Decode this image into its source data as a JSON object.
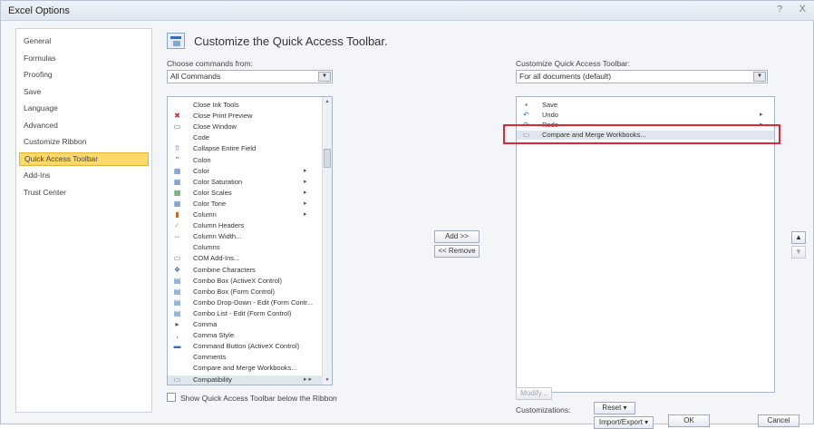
{
  "window": {
    "title": "Excel Options",
    "help_label": "?",
    "close_label": "X"
  },
  "nav": {
    "items": [
      {
        "label": "General"
      },
      {
        "label": "Formulas"
      },
      {
        "label": "Proofing"
      },
      {
        "label": "Save"
      },
      {
        "label": "Language"
      },
      {
        "label": "Advanced"
      },
      {
        "label": "Customize Ribbon"
      },
      {
        "label": "Quick Access Toolbar",
        "selected": true
      },
      {
        "label": "Add-Ins"
      },
      {
        "label": "Trust Center"
      }
    ]
  },
  "main": {
    "heading": "Customize the Quick Access Toolbar.",
    "choose_label": "Choose commands from:",
    "choose_value": "All Commands",
    "customize_label": "Customize Quick Access Toolbar:",
    "customize_value": "For all documents (default)",
    "commands": [
      {
        "label": "Close Ink Tools",
        "icon": "",
        "sub": "",
        "ico_color": "#333"
      },
      {
        "label": "Close Print Preview",
        "icon": "✖",
        "sub": "",
        "ico_color": "#cc3333"
      },
      {
        "label": "Close Window",
        "icon": "▭",
        "sub": "",
        "ico_color": "#555"
      },
      {
        "label": "Code",
        "icon": "",
        "sub": "",
        "ico_color": "#333"
      },
      {
        "label": "Collapse Entire Field",
        "icon": "⇧",
        "sub": "",
        "ico_color": "#3b6db4"
      },
      {
        "label": "Colon",
        "icon": "\"",
        "sub": "",
        "ico_color": "#333"
      },
      {
        "label": "Color",
        "icon": "▦",
        "sub": "▸",
        "ico_color": "#4a7cc0"
      },
      {
        "label": "Color Saturation",
        "icon": "▦",
        "sub": "▸",
        "ico_color": "#4a7cc0"
      },
      {
        "label": "Color Scales",
        "icon": "▦",
        "sub": "▸",
        "ico_color": "#3f8f4a"
      },
      {
        "label": "Color Tone",
        "icon": "▦",
        "sub": "▸",
        "ico_color": "#4a7cc0"
      },
      {
        "label": "Column",
        "icon": "▮",
        "sub": "▸",
        "ico_color": "#c9691f"
      },
      {
        "label": "Column Headers",
        "icon": "✓",
        "sub": "",
        "ico_color": "#d9a020"
      },
      {
        "label": "Column Width...",
        "icon": "⇔",
        "sub": "",
        "ico_color": "#3b6db4"
      },
      {
        "label": "Columns",
        "icon": "",
        "sub": "",
        "ico_color": "#333"
      },
      {
        "label": "COM Add-Ins...",
        "icon": "▭",
        "sub": "",
        "ico_color": "#666"
      },
      {
        "label": "Combine Characters",
        "icon": "❖",
        "sub": "",
        "ico_color": "#3b6db4"
      },
      {
        "label": "Combo Box (ActiveX Control)",
        "icon": "▤",
        "sub": "",
        "ico_color": "#3b6db4"
      },
      {
        "label": "Combo Box (Form Control)",
        "icon": "▤",
        "sub": "",
        "ico_color": "#3b6db4"
      },
      {
        "label": "Combo Drop-Down - Edit (Form Contr...",
        "icon": "▤",
        "sub": "",
        "ico_color": "#3b6db4"
      },
      {
        "label": "Combo List - Edit (Form Control)",
        "icon": "▤",
        "sub": "",
        "ico_color": "#3b6db4"
      },
      {
        "label": "Comma",
        "icon": "▸",
        "sub": "",
        "ico_color": "#555"
      },
      {
        "label": "Comma Style",
        "icon": ",",
        "sub": "",
        "ico_color": "#333"
      },
      {
        "label": "Command Button (ActiveX Control)",
        "icon": "▬",
        "sub": "",
        "ico_color": "#3b6db4"
      },
      {
        "label": "Comments",
        "icon": "",
        "sub": "",
        "ico_color": "#333"
      },
      {
        "label": "Compare and Merge Workbooks...",
        "icon": "",
        "sub": "",
        "ico_color": "#333"
      },
      {
        "label": "Compatibility",
        "icon": "▭",
        "sub": "▸ ▸",
        "ico_color": "#888",
        "selected": true
      }
    ],
    "toolbar_items": [
      {
        "label": "Save",
        "icon": "▪",
        "sub": "",
        "ico_color": "#3b6db4"
      },
      {
        "label": "Undo",
        "icon": "↶",
        "sub": "▸",
        "ico_color": "#3b6db4"
      },
      {
        "label": "Redo",
        "icon": "↷",
        "sub": "▸",
        "ico_color": "#3b6db4"
      },
      {
        "label": "Compare and Merge Workbooks...",
        "icon": "▭",
        "sub": "",
        "ico_color": "#888",
        "selected": true
      }
    ],
    "add_label": "Add >>",
    "remove_label": "<< Remove",
    "modify_label": "Modify...",
    "customizations_label": "Customizations:",
    "reset_label": "Reset ▾",
    "import_export_label": "Import/Export ▾",
    "show_below_label": "Show Quick Access Toolbar below the Ribbon",
    "move_up": "▲",
    "move_down": "▼"
  },
  "footer": {
    "ok_label": "OK",
    "cancel_label": "Cancel"
  },
  "colors": {
    "selected_nav": "#fbd96a",
    "highlight": "#e0263a"
  }
}
